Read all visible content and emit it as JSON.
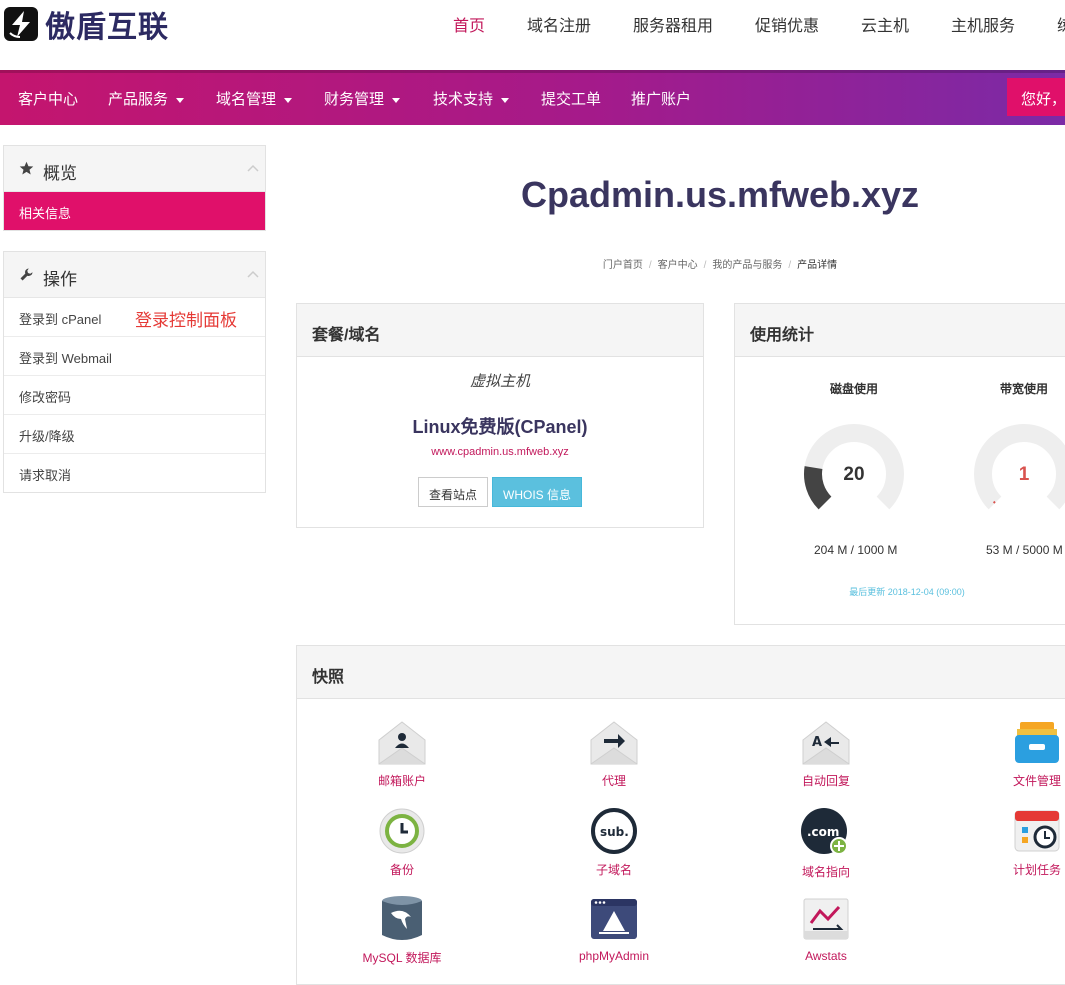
{
  "brand": {
    "name": "傲盾互联"
  },
  "top_nav": [
    "首页",
    "域名注册",
    "服务器租用",
    "促销优惠",
    "云主机",
    "主机服务",
    "练"
  ],
  "main_nav": [
    {
      "label": "客户中心"
    },
    {
      "label": "产品服务"
    },
    {
      "label": "域名管理"
    },
    {
      "label": "财务管理"
    },
    {
      "label": "技术支持"
    },
    {
      "label": "提交工单"
    },
    {
      "label": "推广账户"
    }
  ],
  "greeting": "您好，",
  "sidebar": {
    "overview": {
      "title": "概览",
      "items": [
        "相关信息"
      ]
    },
    "actions": {
      "title": "操作",
      "items": [
        "登录到 cPanel",
        "登录到 Webmail",
        "修改密码",
        "升级/降级",
        "请求取消"
      ],
      "annotation": "登录控制面板"
    }
  },
  "page": {
    "title": "Cpadmin.us.mfweb.xyz"
  },
  "breadcrumb": [
    "门户首页",
    "客户中心",
    "我的产品与服务",
    "产品详情"
  ],
  "package": {
    "header": "套餐/域名",
    "type": "虚拟主机",
    "name": "Linux免费版(CPanel)",
    "domain": "www.cpadmin.us.mfweb.xyz",
    "btn_view": "查看站点",
    "btn_whois": "WHOIS 信息"
  },
  "usage": {
    "header": "使用统计",
    "disk": {
      "label": "磁盘使用",
      "value": 20,
      "used": "204 M / 1000 M",
      "color": "#444444"
    },
    "bandwidth": {
      "label": "带宽使用",
      "value": 1,
      "used": "53 M / 5000 M",
      "color": "#d9534f"
    },
    "last_update": "最后更新 2018-12-04 (09:00)"
  },
  "shortcuts": {
    "header": "快照",
    "items": [
      {
        "label": "邮箱账户",
        "icon": "email-account-icon"
      },
      {
        "label": "代理",
        "icon": "forwarder-icon"
      },
      {
        "label": "自动回复",
        "icon": "autoresponder-icon"
      },
      {
        "label": "文件管理",
        "icon": "file-manager-icon"
      },
      {
        "label": "备份",
        "icon": "backup-icon"
      },
      {
        "label": "子域名",
        "icon": "subdomain-icon"
      },
      {
        "label": "域名指向",
        "icon": "addon-domain-icon"
      },
      {
        "label": "计划任务",
        "icon": "cron-jobs-icon"
      },
      {
        "label": "MySQL 数据库",
        "icon": "mysql-icon"
      },
      {
        "label": "phpMyAdmin",
        "icon": "phpmyadmin-icon"
      },
      {
        "label": "Awstats",
        "icon": "awstats-icon"
      }
    ]
  },
  "colors": {
    "accent": "#e0106a",
    "nav_start": "#c4156e",
    "nav_end": "#7b2aa6",
    "title": "#3a355f",
    "info": "#5bc0de"
  }
}
